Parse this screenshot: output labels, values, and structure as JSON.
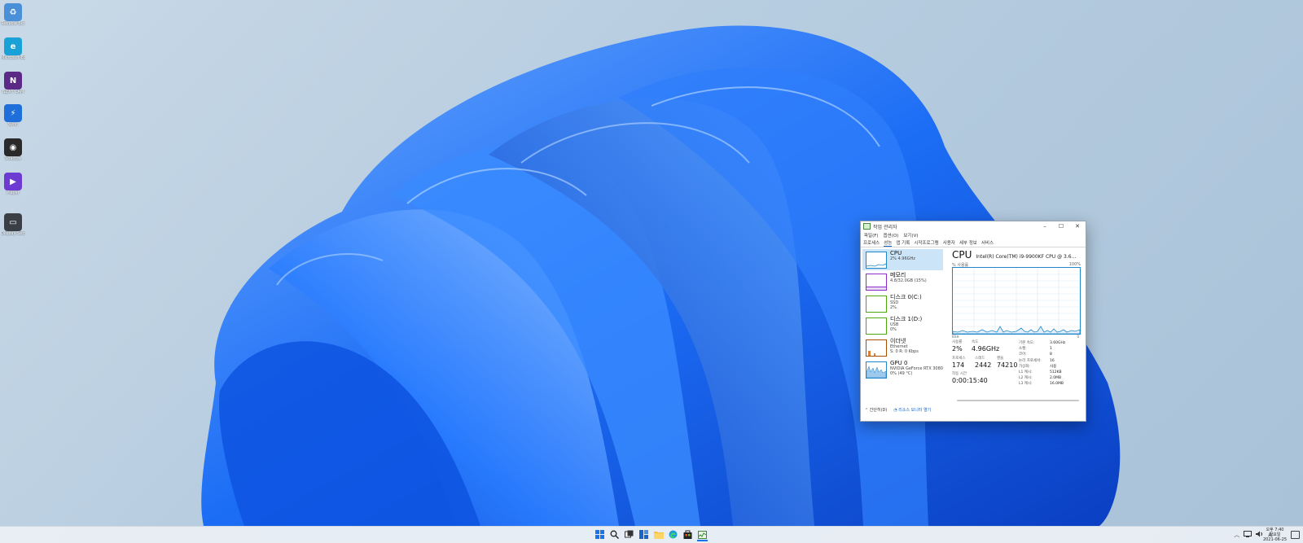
{
  "desktop": {
    "icons": [
      {
        "name": "recycle-bin",
        "label": "Recycle Bin",
        "color": "#4a90d9"
      },
      {
        "name": "edge",
        "label": "Microsoft Edge",
        "color": "#1aa2d8"
      },
      {
        "name": "nzxt-cam",
        "label": "NZXT CAM",
        "color": "#5b2a86"
      },
      {
        "name": "app-blue",
        "label": "Sync",
        "color": "#1e6fd9"
      },
      {
        "name": "app-game",
        "label": "Shadow",
        "color": "#2a2a2a"
      },
      {
        "name": "app-purple",
        "label": "Player",
        "color": "#6d3bd1"
      },
      {
        "name": "app-monitor",
        "label": "Display Settings",
        "color": "#3a3f47"
      }
    ]
  },
  "taskmanager": {
    "title": "작업 관리자",
    "menu": [
      "파일(F)",
      "옵션(O)",
      "보기(V)"
    ],
    "tabs": [
      "프로세스",
      "성능",
      "앱 기록",
      "시작프로그램",
      "사용자",
      "세부 정보",
      "서비스"
    ],
    "active_tab": 1,
    "sidebar": [
      {
        "name": "CPU",
        "sub": "2% 4.96GHz",
        "color": "#1f86c8"
      },
      {
        "name": "메모리",
        "sub": "4.8/32.0GB (15%)",
        "color": "#8b2fc9"
      },
      {
        "name": "디스크 0(C:)",
        "sub": "SSD",
        "sub2": "2%",
        "color": "#4da60c"
      },
      {
        "name": "디스크 1(D:)",
        "sub": "USB",
        "sub2": "0%",
        "color": "#4da60c"
      },
      {
        "name": "이더넷",
        "sub": "Ethernet",
        "sub2": "S: 0 R: 0 Kbps",
        "color": "#a74f01"
      },
      {
        "name": "GPU 0",
        "sub": "NVIDIA GeForce RTX 3080",
        "sub2": "0% (49 °C)",
        "color": "#1f86c8"
      }
    ],
    "main": {
      "title": "CPU",
      "model": "Intel(R) Core(TM) i9-9900KF CPU @ 3.6...",
      "graph_caption": "% 사용률",
      "graph_max": "100%",
      "graph_time": "60초",
      "graph_min": "0",
      "stats": {
        "utilization_label": "사용률",
        "utilization": "2%",
        "speed_label": "속도",
        "speed": "4.96GHz",
        "processes_label": "프로세스",
        "processes": "174",
        "threads_label": "스레드",
        "threads": "2442",
        "handles_label": "핸들",
        "handles": "74210",
        "uptime_label": "작동 시간",
        "uptime": "0:00:15:40"
      },
      "specs": [
        {
          "k": "기본 속도:",
          "v": "3.60GHz"
        },
        {
          "k": "소켓:",
          "v": "1"
        },
        {
          "k": "코어:",
          "v": "8"
        },
        {
          "k": "논리 프로세서:",
          "v": "16"
        },
        {
          "k": "가상화:",
          "v": "사용"
        },
        {
          "k": "L1 캐시:",
          "v": "512KB"
        },
        {
          "k": "L2 캐시:",
          "v": "2.0MB"
        },
        {
          "k": "L3 캐시:",
          "v": "16.0MB"
        }
      ]
    },
    "footer": {
      "brief": "간단히(D)",
      "monitor": "리소스 모니터 열기"
    }
  },
  "taskbar": {
    "icons": [
      "start-icon",
      "search-icon",
      "task-view-icon",
      "widgets-icon",
      "file-explorer-icon",
      "edge-icon",
      "store-icon",
      "taskmgr-icon"
    ],
    "tray": {
      "ime": "A"
    },
    "clock": {
      "time": "오후 7:40",
      "day": "금요일",
      "date": "2021-06-25"
    }
  },
  "colors": {
    "accent": "#0a64c8",
    "cpu_graph": "#1f86c8",
    "wallpaper_blue": "#1a6cf0"
  }
}
